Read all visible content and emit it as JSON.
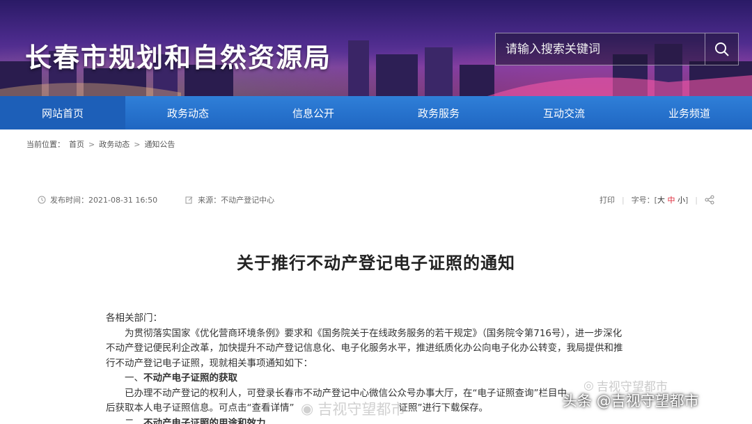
{
  "header": {
    "site_title": "长春市规划和自然资源局",
    "search_placeholder": "请输入搜索关键词",
    "search_icon": "search-icon"
  },
  "nav": {
    "items": [
      {
        "label": "网站首页"
      },
      {
        "label": "政务动态"
      },
      {
        "label": "信息公开"
      },
      {
        "label": "政务服务"
      },
      {
        "label": "互动交流"
      },
      {
        "label": "业务频道"
      }
    ]
  },
  "breadcrumb": {
    "prefix": "当前位置：",
    "items": [
      "首页",
      "政务动态",
      "通知公告"
    ],
    "separator": ">"
  },
  "meta": {
    "publish_label": "发布时间：2021-08-31 16:50",
    "source_label": "来源：不动产登记中心",
    "print": "打印",
    "font_size_label": "字号：[",
    "fs_big": "大",
    "fs_mid": "中",
    "fs_small": "小",
    "fs_close": "]"
  },
  "article": {
    "title": "关于推行不动产登记电子证照的通知",
    "salutation": "各相关部门：",
    "para1_line1": "为贯彻落实国家《优化营商环境条例》要求和《国务院关于在线政务服务的若干规定》（国务院令第716号），进一步深化",
    "para1_line2": "不动产登记便民利企改革，加快提升不动产登记信息化、电子化服务水平，推进纸质化办公向电子化办公转变，我局提供和推",
    "para1_line3": "行不动产登记电子证照，现就相关事项通知如下：",
    "heading1_num": "一、",
    "heading1": "不动产电子证照的获取",
    "para2_line1": "已办理不动产登记的权利人，可登录长春市不动产登记中心微信公众号办事大厅，在“电子证照查询”栏目中",
    "para2_line2": "后获取本人电子证照信息。可点击“查看详情”",
    "para2_line2b": "证照”进行下载保存。",
    "heading2_num": "二、",
    "heading2": "不动产电子证照的用途和效力"
  },
  "watermarks": {
    "toutiao": "头条 @吉视守望都市",
    "wechat": "吉视守望都市",
    "weibo": "吉视守望都市"
  },
  "colors": {
    "nav_blue": "#2372cf",
    "banner_purple": "#4a2a8a",
    "font_mid_red": "#d23"
  }
}
